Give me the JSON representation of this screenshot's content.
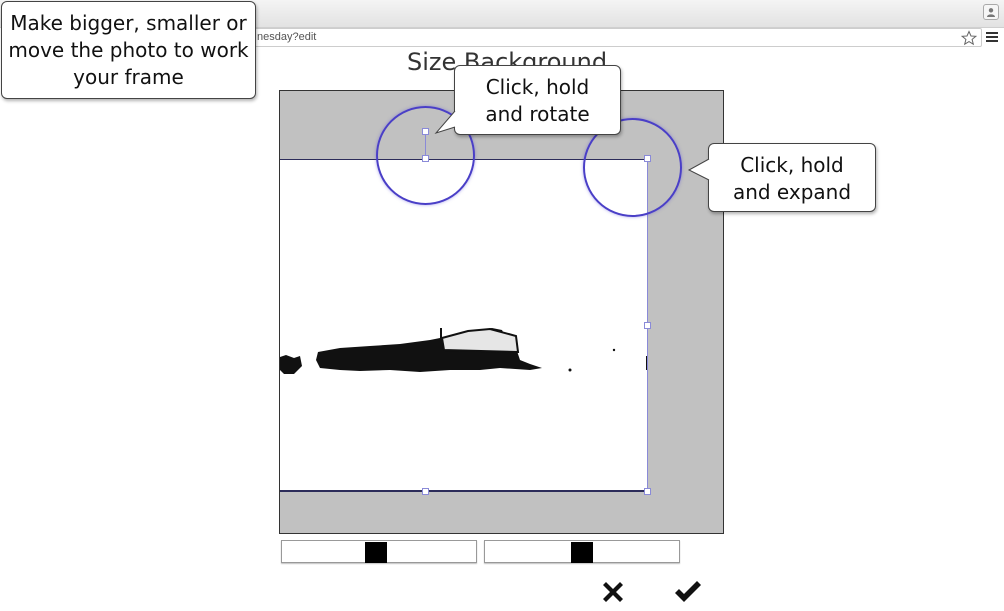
{
  "browser": {
    "url_fragment": "nesday?edit"
  },
  "page": {
    "title": "Size Background"
  },
  "callouts": {
    "move_photo": "Make bigger, smaller or move the photo to work your frame",
    "rotate": "Click, hold and rotate",
    "expand": "Click, hold and expand"
  },
  "sliders": [
    {
      "name": "scale",
      "level": 0.48
    },
    {
      "name": "rotation",
      "level": 0.5
    }
  ],
  "actions": {
    "cancel_icon": "x-icon",
    "confirm_icon": "check-icon"
  },
  "colors": {
    "frame": "#c1c1c1",
    "selection": "#8a8ad8",
    "ring": "#4a3fc7"
  }
}
